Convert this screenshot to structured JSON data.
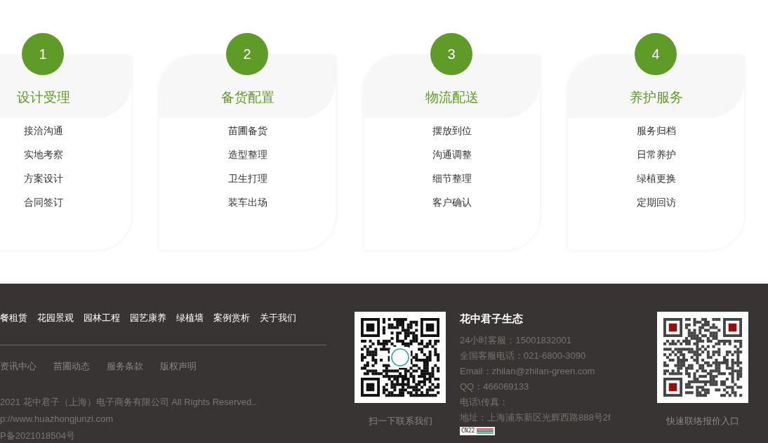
{
  "steps": [
    {
      "number": "1",
      "title": "设计受理",
      "items": [
        "接洽沟通",
        "实地考察",
        "方案设计",
        "合同签订"
      ]
    },
    {
      "number": "2",
      "title": "备货配置",
      "items": [
        "苗圃备货",
        "造型整理",
        "卫生打理",
        "装车出场"
      ]
    },
    {
      "number": "3",
      "title": "物流配送",
      "items": [
        "摆放到位",
        "沟通调整",
        "细节整理",
        "客户确认"
      ]
    },
    {
      "number": "4",
      "title": "养护服务",
      "items": [
        "服务归档",
        "日常养护",
        "绿植更换",
        "定期回访"
      ]
    }
  ],
  "footer": {
    "nav_links": [
      "餐租赁",
      "花园景观",
      "园林工程",
      "园艺康养",
      "绿植墙",
      "案例赏析",
      "关于我们"
    ],
    "secondary_links": [
      "资讯中心",
      "苗圃动态",
      "服务条款",
      "版权声明"
    ],
    "copyright_lines": [
      "2021 花中君子（上海）电子商务有限公司 All Rights Reserved..",
      "p://www.huazhongjunzi.com",
      "P备2021018504号"
    ],
    "qr_left_caption": "扫一下联系我们",
    "contact": {
      "title": "花中君子生态",
      "lines": [
        "24小时客服：15001832001",
        "全国客服电话：021-6800-3090",
        "Email：zhilan@zhilan-green.com",
        "QQ：466069133",
        "电话\\传真：",
        "地址：上海浦东新区光辉西路888号2f"
      ],
      "badge": "CN22"
    },
    "qr_right_caption": "快速联络报价入口"
  }
}
